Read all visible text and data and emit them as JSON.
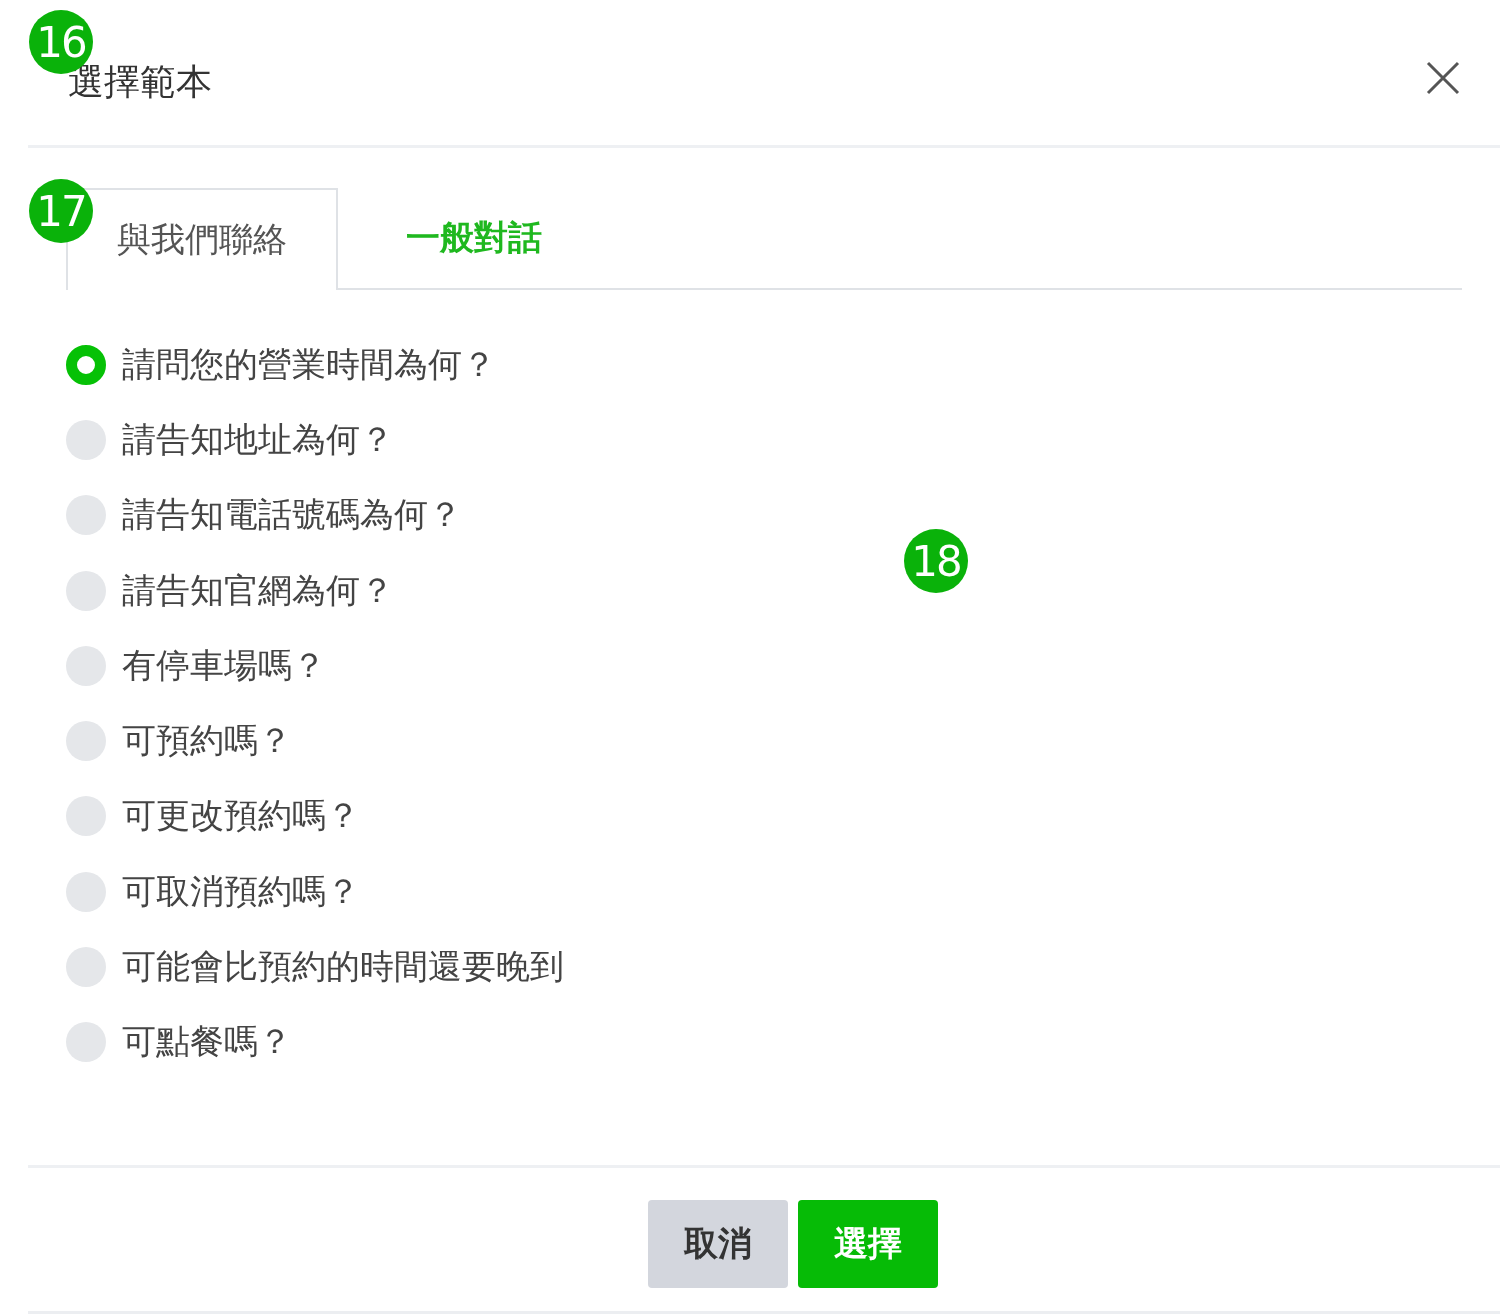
{
  "dialog": {
    "title": "選擇範本"
  },
  "tabs": [
    {
      "label": "與我們聯絡",
      "selected": true
    },
    {
      "label": "一般對話",
      "selected": false
    }
  ],
  "options": [
    {
      "label": "請問您的營業時間為何？",
      "selected": true
    },
    {
      "label": "請告知地址為何？",
      "selected": false
    },
    {
      "label": "請告知電話號碼為何？",
      "selected": false
    },
    {
      "label": "請告知官網為何？",
      "selected": false
    },
    {
      "label": "有停車場嗎？",
      "selected": false
    },
    {
      "label": "可預約嗎？",
      "selected": false
    },
    {
      "label": "可更改預約嗎？",
      "selected": false
    },
    {
      "label": "可取消預約嗎？",
      "selected": false
    },
    {
      "label": "可能會比預約的時間還要晚到",
      "selected": false
    },
    {
      "label": "可點餐嗎？",
      "selected": false
    }
  ],
  "buttons": [
    {
      "label": "取消",
      "kind": "secondary"
    },
    {
      "label": "選擇",
      "kind": "primary"
    }
  ],
  "markers": [
    {
      "label": "16"
    },
    {
      "label": "17"
    },
    {
      "label": "18"
    }
  ]
}
